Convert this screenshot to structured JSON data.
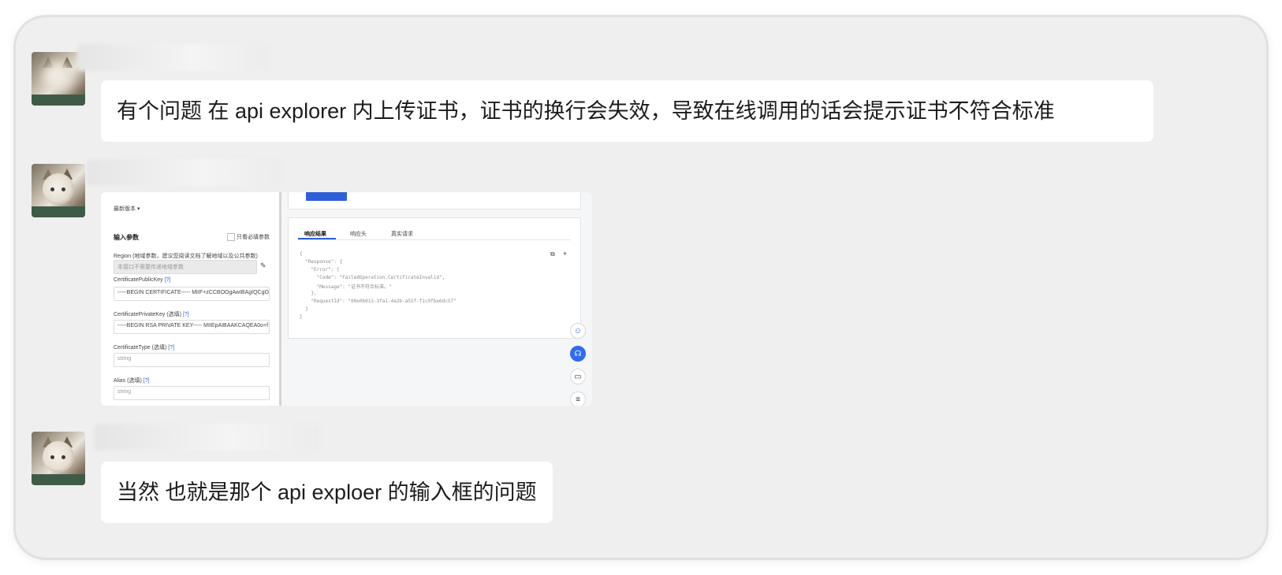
{
  "messages": [
    {
      "text": "有个问题 在 api explorer 内上传证书，证书的换行会失效，导致在线调用的话会提示证书不符合标准"
    },
    {
      "screenshot": {
        "version_label": "最新版本 ▾",
        "input_params_title": "输入参数",
        "only_required_label": "只看必填参数",
        "region_label": "Region (地域参数，建议您阅读文档了解地域以及公共参数)",
        "region_placeholder": "本接口不需要传递地域参数",
        "public_key_label": "CertificatePublicKey",
        "public_key_value": "-----BEGIN CERTIFICATE----- MIIF+zCCBOOgAwIBAgIQCgO",
        "private_key_label": "CertificatePrivateKey",
        "private_key_value": "-----BEGIN RSA PRIVATE KEY----- MIIEpAIBAAKCAQEA0o+f",
        "type_label": "CertificateType",
        "alias_label": "Alias",
        "optional_tag": "(选填)",
        "required_tag": "[?]",
        "string_placeholder": "string",
        "tabs": [
          "响应结果",
          "响应头",
          "真实请求"
        ],
        "response_lines": [
          "{",
          "  \"Response\": {",
          "    \"Error\": {",
          "      \"Code\": \"FailedOperation.CertificateInvalid\",",
          "      \"Message\": \"证书不符合标准。\"",
          "    },",
          "    \"RequestId\": \"00e0b013-3fa1-4a2b-a55f-f1c9fbe6dc57\"",
          "  }",
          "}"
        ]
      }
    },
    {
      "text": "当然 也就是那个 api exploer 的输入框的问题"
    }
  ],
  "icons": [
    "copy-icon",
    "plus-icon",
    "smile-icon",
    "headset-icon",
    "book-icon",
    "list-icon"
  ],
  "colors": {
    "accent": "#2e6cf0",
    "bubble": "#ffffff",
    "background": "#efefef"
  }
}
